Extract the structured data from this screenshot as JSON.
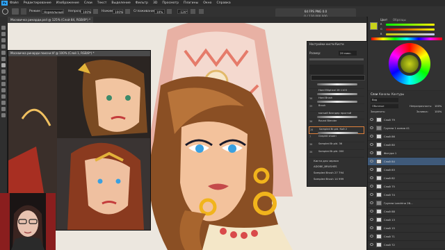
{
  "menu": {
    "logo": "Ps",
    "items": [
      "Файл",
      "Редактирование",
      "Изображение",
      "Слои",
      "Текст",
      "Выделение",
      "Фильтр",
      "3D",
      "Просмотр",
      "Плагины",
      "Окно",
      "Справка"
    ]
  },
  "options": {
    "mode_label": "Режим:",
    "mode_value": "Нормальный",
    "opacity_label": "Непрозр.:",
    "opacity_value": "100%",
    "flow_label": "Нажим:",
    "flow_value": "100%",
    "smoothing_label": "Сглаживание:",
    "smoothing_value": "10%",
    "angle_value": "-120°"
  },
  "doc_status": {
    "line1": "64 FPS  PNG  0.0",
    "line2": "0 / 120  000  000"
  },
  "tabs": {
    "main": "Москвичка ринарди.psd @ 125% (Слой 84, RGB/8*) *",
    "reference": "Москвичка ринарди поиски.tif @ 100% (Слой 1, RGB/8*) *"
  },
  "brushes": {
    "tab_settings": "Настройки кисти",
    "tab_brushes": "Кисти",
    "size_label": "Размер:",
    "size_value": "29 пикс.",
    "rows": [
      {
        "num": "",
        "name": "",
        "name2": ""
      },
      {
        "num": "",
        "name": "Hard Elliptical 28 1103",
        "name2": ""
      },
      {
        "num": "36",
        "name": "Hard Brush",
        "name2": ""
      },
      {
        "num": "39",
        "name": "Brush",
        "name2": ""
      },
      {
        "num": "",
        "name": "мягкий блэндер простой",
        "name2": ""
      },
      {
        "num": "36",
        "name": "Round Blender",
        "name2": ""
      },
      {
        "num": "28",
        "name": "Sampled Br.pld. Кой 2",
        "name2": ""
      },
      {
        "num": "7",
        "name": "Graphit shadri",
        "name2": ""
      },
      {
        "num": "36",
        "name": "Sampled Br.pld. 36",
        "name2": ""
      },
      {
        "num": "36",
        "name": "Sampled Br.pld. 000",
        "name2": ""
      }
    ],
    "folders": [
      "Кисти для чернил",
      "ADOBE_BRUSHES"
    ],
    "extra": [
      "Sampled Brush 27 794",
      "Sampled Brush 14 999"
    ]
  },
  "color_panel": {
    "tab_color": "Цвет",
    "tab_swatches": "Образцы",
    "slider_labels": [
      "R",
      "G",
      "B"
    ]
  },
  "layers_panel": {
    "tab_layers": "Слои",
    "tab_channels": "Каналы",
    "tab_paths": "Контуры",
    "search": "Вид",
    "blend": "Обычные",
    "opacity_label": "Непрозрачность:",
    "opacity_value": "100%",
    "lock_label": "Закрепить:",
    "fill_label": "Заливка:",
    "fill_value": "100%",
    "layers": [
      "Слой 79",
      "Группа 1 копия 41",
      "Слой 86",
      "Слой 80",
      "Фигура 1",
      "Слой 84",
      "Слой 83",
      "Слой 82",
      "Слой 75",
      "Слой 74",
      "Группа Londrina 26...",
      "Слой 88",
      "Слой 13",
      "Слой 15",
      "Слой 71",
      "Слой 72"
    ]
  },
  "colors": {
    "foreground": "#c9d31a",
    "background": "#ffffff",
    "selection": "#3f5a7a"
  }
}
